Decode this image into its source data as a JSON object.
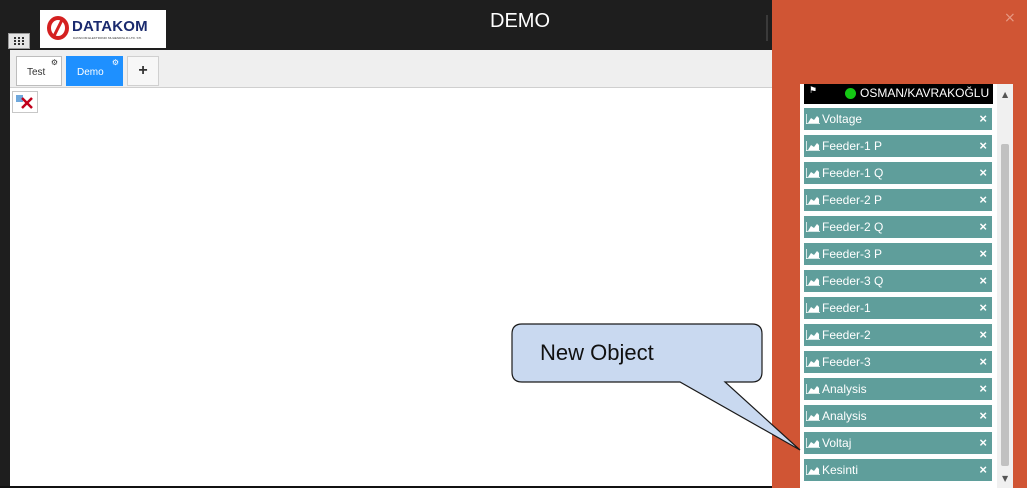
{
  "window": {
    "title": "DEMO"
  },
  "logo": {
    "brand": "DATAKOM",
    "tagline": "DATAKOM ELEKTRONIK MUHENDISLIK LTD. STI."
  },
  "tabs": [
    {
      "label": "Test",
      "active": false
    },
    {
      "label": "Demo",
      "active": true
    }
  ],
  "add_tab_label": "+",
  "callout": {
    "text": "New Object"
  },
  "panel": {
    "close_label": "×",
    "user": "OSMAN/KAVRAKOĞLU",
    "user_status": "online",
    "items": [
      {
        "label": "Voltage"
      },
      {
        "label": "Feeder-1 P"
      },
      {
        "label": "Feeder-1 Q"
      },
      {
        "label": "Feeder-2 P"
      },
      {
        "label": "Feeder-2 Q"
      },
      {
        "label": "Feeder-3 P"
      },
      {
        "label": "Feeder-3 Q"
      },
      {
        "label": "Feeder-1"
      },
      {
        "label": "Feeder-2"
      },
      {
        "label": "Feeder-3"
      },
      {
        "label": "Analysis"
      },
      {
        "label": "Analysis"
      },
      {
        "label": "Voltaj"
      },
      {
        "label": "Kesinti"
      }
    ],
    "remove_label": "×"
  },
  "colors": {
    "panel_bg": "#d05534",
    "item_bg": "#5f9e9b",
    "active_tab": "#1e90ff",
    "callout_fill": "#c9d9f0"
  }
}
